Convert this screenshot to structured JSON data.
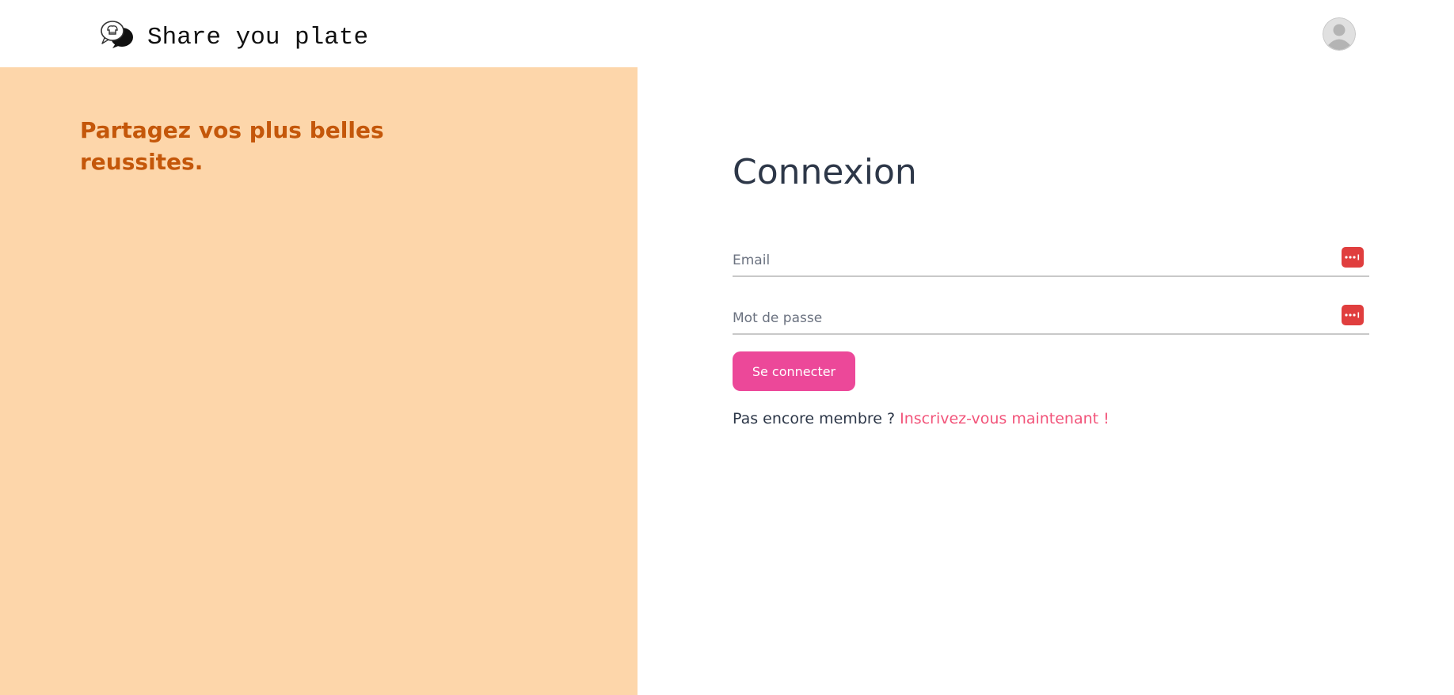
{
  "header": {
    "brand": "Share you plate",
    "logo_icon": "chef-chat-bubble-icon",
    "avatar_icon": "user-avatar-icon"
  },
  "left_panel": {
    "tagline": "Partagez vos plus belles reussites.",
    "background_color": "#fdd6aa",
    "text_color": "#c4570a"
  },
  "login": {
    "title": "Connexion",
    "email_placeholder": "Email",
    "password_placeholder": "Mot de passe",
    "password_manager_icon": "password-manager-icon",
    "submit_label": "Se connecter",
    "signup_prompt": "Pas encore membre ?",
    "signup_link": "Inscrivez-vous maintenant !",
    "button_color": "#ec4899",
    "link_color": "#f2547a"
  }
}
